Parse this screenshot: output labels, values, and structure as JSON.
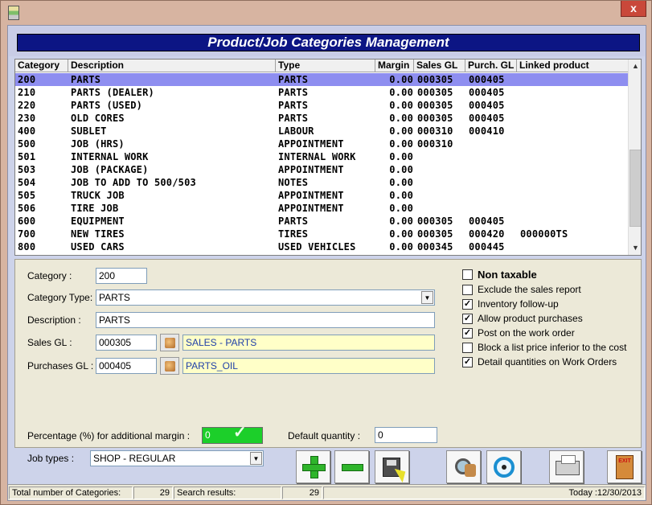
{
  "window": {
    "close_label": "x"
  },
  "header": {
    "title": "Product/Job Categories Management"
  },
  "grid": {
    "columns": [
      "Category",
      "Description",
      "Type",
      "Margin",
      "Sales GL",
      "Purch. GL",
      "Linked product"
    ],
    "rows": [
      [
        "200",
        "PARTS",
        "PARTS",
        "0.00",
        "000305",
        "000405",
        ""
      ],
      [
        "210",
        "PARTS (DEALER)",
        "PARTS",
        "0.00",
        "000305",
        "000405",
        ""
      ],
      [
        "220",
        "PARTS (USED)",
        "PARTS",
        "0.00",
        "000305",
        "000405",
        ""
      ],
      [
        "230",
        "OLD CORES",
        "PARTS",
        "0.00",
        "000305",
        "000405",
        ""
      ],
      [
        "400",
        "SUBLET",
        "LABOUR",
        "0.00",
        "000310",
        "000410",
        ""
      ],
      [
        "500",
        "JOB (HRS)",
        "APPOINTMENT",
        "0.00",
        "000310",
        "",
        ""
      ],
      [
        "501",
        "INTERNAL WORK",
        "INTERNAL WORK",
        "0.00",
        "",
        "",
        ""
      ],
      [
        "503",
        "JOB (PACKAGE)",
        "APPOINTMENT",
        "0.00",
        "",
        "",
        ""
      ],
      [
        "504",
        "JOB TO ADD TO 500/503",
        "NOTES",
        "0.00",
        "",
        "",
        ""
      ],
      [
        "505",
        "TRUCK JOB",
        "APPOINTMENT",
        "0.00",
        "",
        "",
        ""
      ],
      [
        "506",
        "TIRE JOB",
        "APPOINTMENT",
        "0.00",
        "",
        "",
        ""
      ],
      [
        "600",
        "EQUIPMENT",
        "PARTS",
        "0.00",
        "000305",
        "000405",
        ""
      ],
      [
        "700",
        "NEW TIRES",
        "TIRES",
        "0.00",
        "000305",
        "000420",
        "000000TS"
      ],
      [
        "800",
        "USED CARS",
        "USED VEHICLES",
        "0.00",
        "000345",
        "000445",
        ""
      ]
    ],
    "selected_index": 0
  },
  "form": {
    "category_label": "Category :",
    "category_value": "200",
    "category_type_label": "Category Type:",
    "category_type_value": "PARTS",
    "description_label": "Description :",
    "description_value": "PARTS",
    "sales_gl_label": "Sales GL :",
    "sales_gl_value": "000305",
    "sales_gl_name": "SALES - PARTS",
    "purchases_gl_label": "Purchases GL :",
    "purchases_gl_value": "000405",
    "purchases_gl_name": "PARTS_OIL",
    "percentage_label": "Percentage (%) for additional margin :",
    "percentage_value": "0",
    "default_qty_label": "Default quantity :",
    "default_qty_value": "0",
    "job_types_label": "Job types :",
    "job_types_value": "SHOP - REGULAR"
  },
  "options": [
    {
      "label": "Non taxable",
      "checked": false,
      "bold": true
    },
    {
      "label": "Exclude the sales report",
      "checked": false,
      "bold": false
    },
    {
      "label": "Inventory follow-up",
      "checked": true,
      "bold": false
    },
    {
      "label": "Allow product purchases",
      "checked": true,
      "bold": false
    },
    {
      "label": "Post on the work order",
      "checked": true,
      "bold": false
    },
    {
      "label": "Block a list price inferior to the cost",
      "checked": false,
      "bold": false
    },
    {
      "label": "Detail quantities on Work Orders",
      "checked": true,
      "bold": false
    }
  ],
  "toolbar": {
    "exit_label": "EXIT"
  },
  "status": {
    "total_label": "Total number of Categories:",
    "total_value": "29",
    "search_label": "Search results:",
    "search_value": "29",
    "today": "Today :12/30/2013"
  },
  "colors": {
    "header_bg": "#0c1584",
    "selected_row": "#8e8ef0",
    "green_field": "#1ccf2a",
    "gl_name_bg": "#ffffc8"
  }
}
